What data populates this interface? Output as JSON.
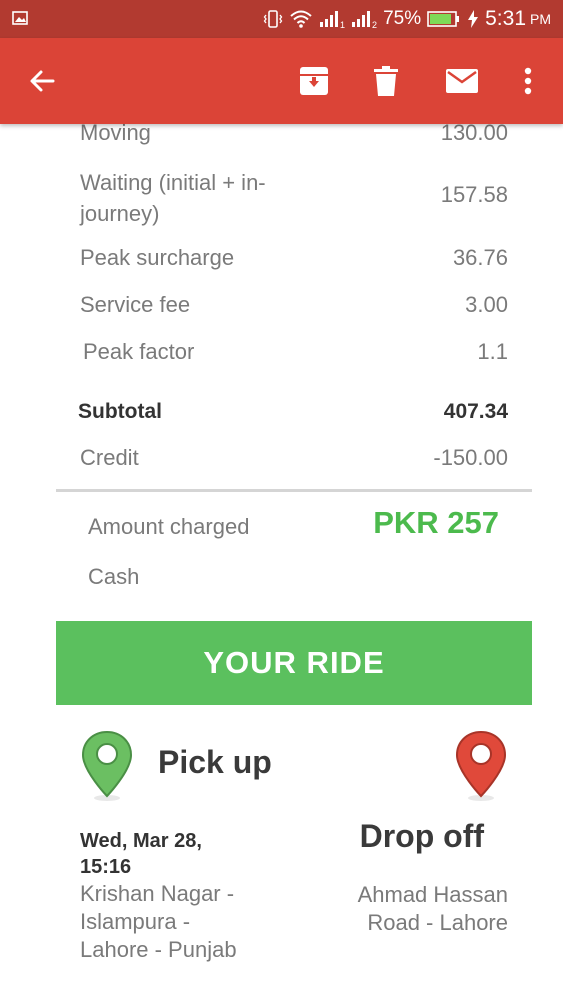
{
  "status_bar": {
    "battery_percent": "75%",
    "time": "5:31",
    "ampm": "PM",
    "sim1_label": "1",
    "sim2_label": "2"
  },
  "app_bar": {
    "icons": [
      "back-arrow-icon",
      "archive-icon",
      "delete-icon",
      "mail-icon",
      "more-vert-icon"
    ],
    "color": "#db4437"
  },
  "fare_breakdown": [
    {
      "label": "Moving",
      "value": "130.00"
    },
    {
      "label": "Waiting (initial + in-journey)",
      "label_line1": "Waiting (initial + in-",
      "label_line2": "journey)",
      "value": "157.58"
    },
    {
      "label": "Peak surcharge",
      "value": "36.76"
    },
    {
      "label": "Service fee",
      "value": "3.00"
    },
    {
      "label": "Peak factor",
      "value": "1.1"
    }
  ],
  "subtotal": {
    "label": "Subtotal",
    "value": "407.34"
  },
  "credit": {
    "label": "Credit",
    "value": "-150.00"
  },
  "amount": {
    "label": "Amount charged",
    "value": "PKR 257",
    "payment_method": "Cash"
  },
  "ride_banner": {
    "label": "YOUR RIDE",
    "color": "#5bc05e"
  },
  "pickup": {
    "title": "Pick up",
    "date_line1": "Wed, Mar 28,",
    "date_line2": "15:16",
    "address_line1": "Krishan Nagar -",
    "address_line2": "Islampura -",
    "address_line3": "Lahore - Punjab"
  },
  "dropoff": {
    "title": "Drop off",
    "address_line1": "Ahmad Hassan",
    "address_line2": "Road - Lahore"
  },
  "colors": {
    "accent_green": "#4cba4d",
    "pin_green": "#6bbf62",
    "pin_red": "#e0493a"
  }
}
